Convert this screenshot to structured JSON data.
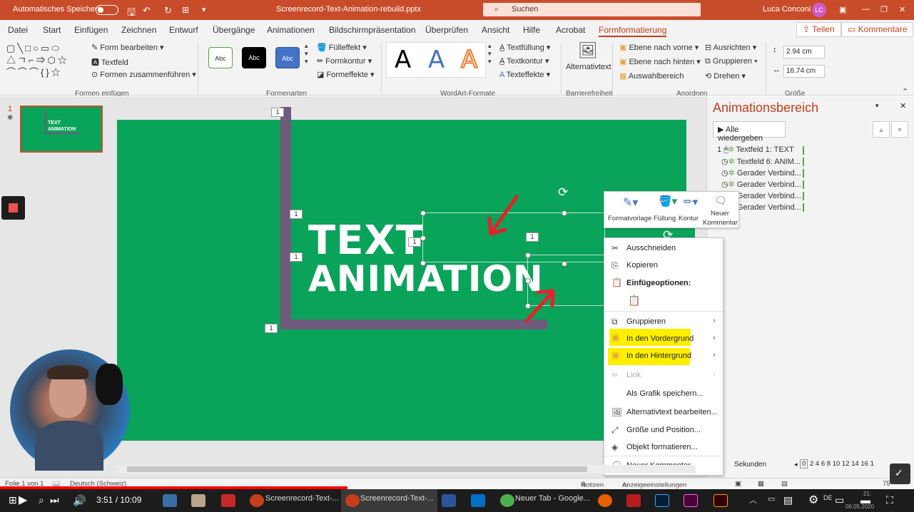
{
  "titlebar": {
    "autosave_label": "Automatisches Speichern",
    "filename": "Screenrecord-Text-Animation-rebuild.pptx",
    "search_placeholder": "Suchen",
    "user_name": "Luca Conconi",
    "user_initials": "LC",
    "bg_color": "#c94c2a"
  },
  "tabs": [
    "Datei",
    "Start",
    "Einfügen",
    "Zeichnen",
    "Entwurf",
    "Übergänge",
    "Animationen",
    "Bildschirmpräsentation",
    "Überprüfen",
    "Ansicht",
    "Hilfe",
    "Acrobat",
    "Formformatierung"
  ],
  "active_tab": "Formformatierung",
  "share_label": "Teilen",
  "comments_label": "Kommentare",
  "ribbon": {
    "shapes_group": {
      "edit_shape": "Form bearbeiten",
      "textbox": "Textfeld",
      "merge": "Formen zusammenführen",
      "label": "Formen einfügen"
    },
    "styles_group": {
      "samples": [
        "Abc",
        "Abc",
        "Abc"
      ],
      "fill": "Fülleffekt",
      "outline": "Formkontur",
      "effects": "Formeffekte",
      "label": "Formenarten"
    },
    "wordart_group": {
      "sample": "A",
      "text_fill": "Textfüllung",
      "text_outline": "Textkontur",
      "text_effects": "Texteffekte",
      "label": "WordArt-Formate"
    },
    "accessibility_group": {
      "alt_text": "Alternativtext",
      "label": "Barrierefreiheit"
    },
    "arrange_group": {
      "bring_forward": "Ebene nach vorne",
      "send_backward": "Ebene nach hinten",
      "selection_pane": "Auswahlbereich",
      "align": "Ausrichten",
      "group": "Gruppieren",
      "rotate": "Drehen",
      "label": "Anordnen"
    },
    "size_group": {
      "height": "2.94 cm",
      "width": "16.74 cm",
      "label": "Größe"
    }
  },
  "thumbnail": {
    "number": "1",
    "text1": "TEXT",
    "text2": "ANIMATION"
  },
  "slide": {
    "line1": "TEXT",
    "line2": "ANIMATION",
    "tags": [
      "1",
      "1",
      "1",
      "1",
      "1",
      "1"
    ],
    "green": "#0aa35a",
    "purple": "#6f5a7c"
  },
  "animation_pane": {
    "title": "Animationsbereich",
    "play_all": "Alle wiedergeben",
    "items": [
      {
        "num": "1",
        "label": "Textfeld 1: TEXT"
      },
      {
        "num": "",
        "label": "Textfeld 6: ANIM..."
      },
      {
        "num": "",
        "label": "Gerader Verbind..."
      },
      {
        "num": "",
        "label": "Gerader Verbind..."
      },
      {
        "num": "",
        "label": "Gerader Verbind..."
      },
      {
        "num": "",
        "label": "Gerader Verbind..."
      }
    ],
    "seconds_label": "Sekunden",
    "timeline": [
      "0",
      "2",
      "4",
      "6",
      "8",
      "10",
      "12",
      "14",
      "16",
      "1"
    ]
  },
  "mini_toolbar": {
    "style": "Formatvorlage",
    "fill": "Füllung",
    "outline": "Kontur",
    "new_comment_1": "Neuer",
    "new_comment_2": "Kommentar"
  },
  "context_menu": {
    "cut": "Ausschneiden",
    "copy": "Kopieren",
    "paste_options": "Einfügeoptionen:",
    "group": "Gruppieren",
    "bring_front": "In den Vordergrund",
    "send_back": "In den Hintergrund",
    "link": "Link",
    "save_as_graphic": "Als Grafik speichern...",
    "edit_alt": "Alternativtext bearbeiten...",
    "size_position": "Größe und Position...",
    "format_object": "Objekt formatieren...",
    "new_comment": "Neuer Kommentar"
  },
  "statusbar": {
    "slide_info": "Folie 1 von 1",
    "language": "Deutsch (Schweiz)",
    "notes": "Notizen",
    "display": "Anzeigeeinstellungen",
    "zoom": "75"
  },
  "video": {
    "time": "3:51 / 10:09",
    "progress": 0.38
  },
  "taskbar": {
    "app1": "Screenrecord-Text-...",
    "app2": "Screenrecord-Text-...",
    "browser": "Neuer Tab - Google...",
    "lang": "DE",
    "time": "21:",
    "date": "06.05.2020"
  }
}
